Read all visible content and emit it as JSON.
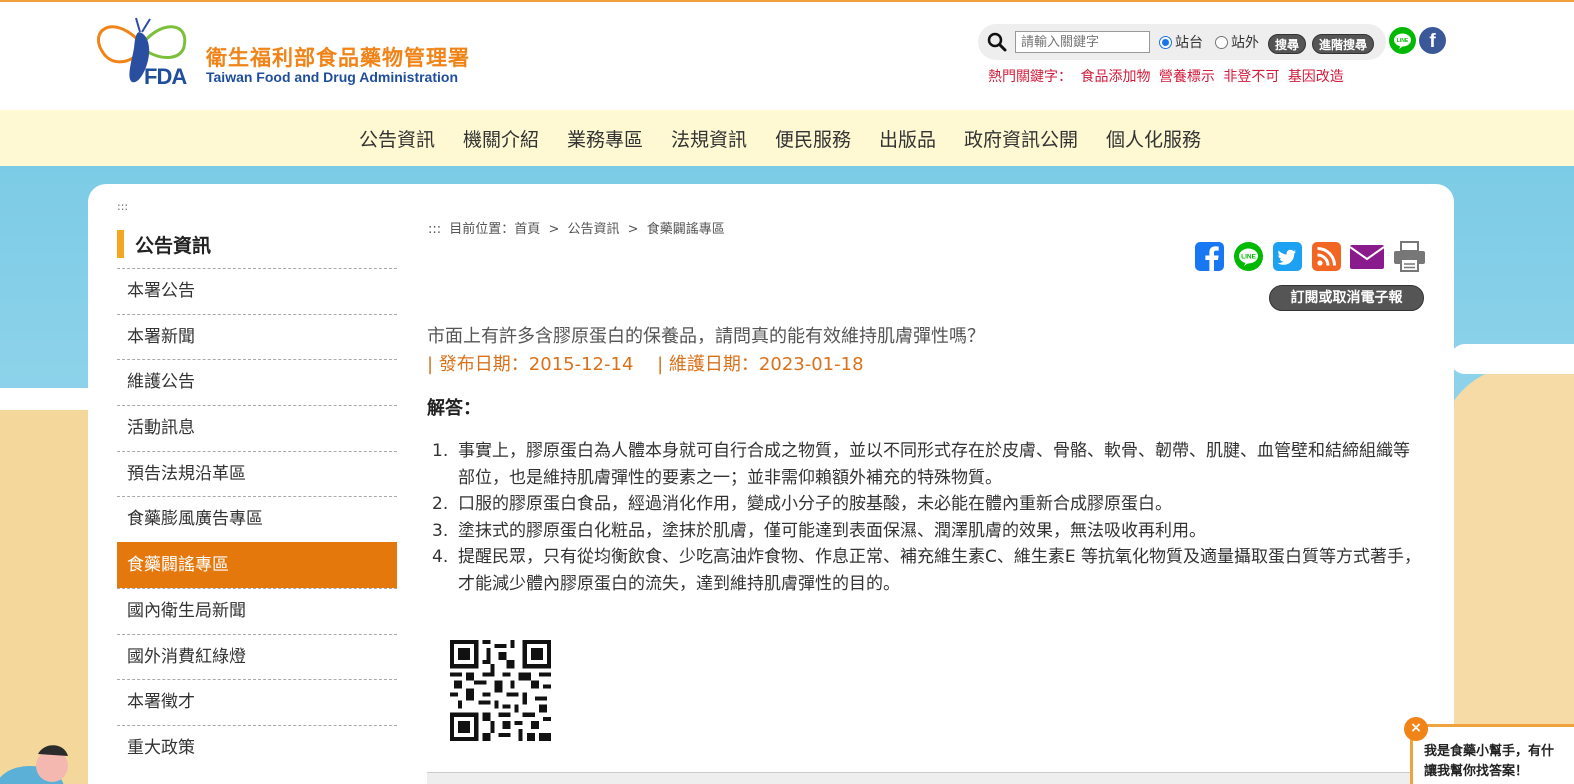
{
  "header": {
    "site_title": "衛生福利部食品藥物管理署",
    "site_subtitle": "Taiwan Food and Drug Administration",
    "logo_text": "FDA",
    "search_placeholder": "請輸入關鍵字",
    "radio_site": "站台",
    "radio_external": "站外",
    "search_button": "搜尋",
    "advanced_search_button": "進階搜尋",
    "hot_label": "熱門關鍵字：",
    "hot_keywords": [
      "食品添加物",
      "營養標示",
      "非登不可",
      "基因改造"
    ],
    "line_icon": "LINE",
    "fb_icon": "f"
  },
  "nav": {
    "items": [
      "公告資訊",
      "機關介紹",
      "業務專區",
      "法規資訊",
      "便民服務",
      "出版品",
      "政府資訊公開",
      "個人化服務"
    ]
  },
  "sidebar": {
    "accesskey": ":::",
    "heading": "公告資訊",
    "items": [
      "本署公告",
      "本署新聞",
      "維護公告",
      "活動訊息",
      "預告法規沿革區",
      "食藥膨風廣告專區",
      "食藥闢謠專區",
      "國內衛生局新聞",
      "國外消費紅綠燈",
      "本署徵才",
      "重大政策"
    ],
    "active_index": 6
  },
  "breadcrumb": {
    "accesskey": ":::",
    "label": "目前位置：",
    "home": "首頁",
    "sep1": ">",
    "section": "公告資訊",
    "sep2": ">",
    "current": "食藥闢謠專區"
  },
  "toolbar": {
    "subscribe_button": "訂閱或取消電子報"
  },
  "article": {
    "title": "市面上有許多含膠原蛋白的保養品，請問真的能有效維持肌膚彈性嗎？",
    "publish_date": "| 發布日期：2015-12-14",
    "maintain_date": "| 維護日期：2023-01-18",
    "answer_label": "解答：",
    "answers": [
      {
        "num": "1.",
        "text": "事實上，膠原蛋白為人體本身就可自行合成之物質，並以不同形式存在於皮膚、骨骼、軟骨、韌帶、肌腱、血管壁和結締組織等部位，也是維持肌膚彈性的要素之一；並非需仰賴額外補充的特殊物質。"
      },
      {
        "num": "2.",
        "text": "口服的膠原蛋白食品，經過消化作用，變成小分子的胺基酸，未必能在體內重新合成膠原蛋白。"
      },
      {
        "num": "3.",
        "text": "塗抹式的膠原蛋白化粧品，塗抹於肌膚，僅可能達到表面保濕、潤澤肌膚的效果，無法吸收再利用。"
      },
      {
        "num": "4.",
        "text": "提醒民眾，只有從均衡飲食、少吃高油炸食物、作息正常、補充維生素C、維生素E 等抗氧化物質及適量攝取蛋白質等方式著手，才能減少體內膠原蛋白的流失，達到維持肌膚彈性的目的。"
      }
    ]
  },
  "chat": {
    "close": "×",
    "line1": "我是食藥小幫手，有什",
    "line2": "讓我幫你找答案！"
  },
  "colors": {
    "accent_orange": "#e5780d",
    "brand_blue": "#1e4e9c",
    "date_orange": "#d9721b",
    "hot_red": "#d21c3c",
    "nav_bg": "#fef9d3"
  }
}
